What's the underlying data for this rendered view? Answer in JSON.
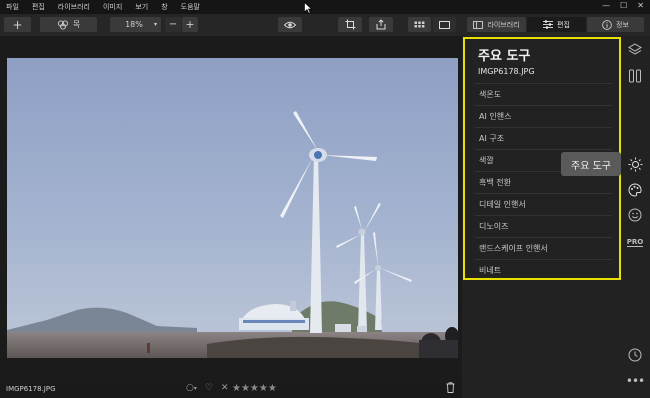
{
  "menu": [
    "파일",
    "편집",
    "라이브러리",
    "이미지",
    "보기",
    "창",
    "도움말"
  ],
  "toolbar": {
    "add_label": "+",
    "filter_label": "목",
    "zoom_value": "18%",
    "zoom_out": "−",
    "zoom_in": "+"
  },
  "tabs": {
    "library": "라이브러리",
    "edit": "편집",
    "info": "정보"
  },
  "panel": {
    "title": "주요 도구",
    "filename": "IMGP6178.JPG",
    "tools": [
      "색온도",
      "AI 인핸스",
      "AI 구조",
      "색깔",
      "흑백 전환",
      "디테일 인핸서",
      "디노이즈",
      "랜드스케이프 인핸서",
      "비네트"
    ]
  },
  "tooltip": "주요 도구",
  "status": {
    "filename": "IMGP6178.JPG",
    "stars": "★★★★★"
  },
  "colors": {
    "highlight": "#e8e000",
    "background": "#1e1e1e",
    "panel": "#222222"
  },
  "side_icons": [
    "layers-icon",
    "compare-icon",
    "sun-icon",
    "palette-icon",
    "face-icon",
    "pro-icon",
    "history-icon",
    "more-icon"
  ]
}
